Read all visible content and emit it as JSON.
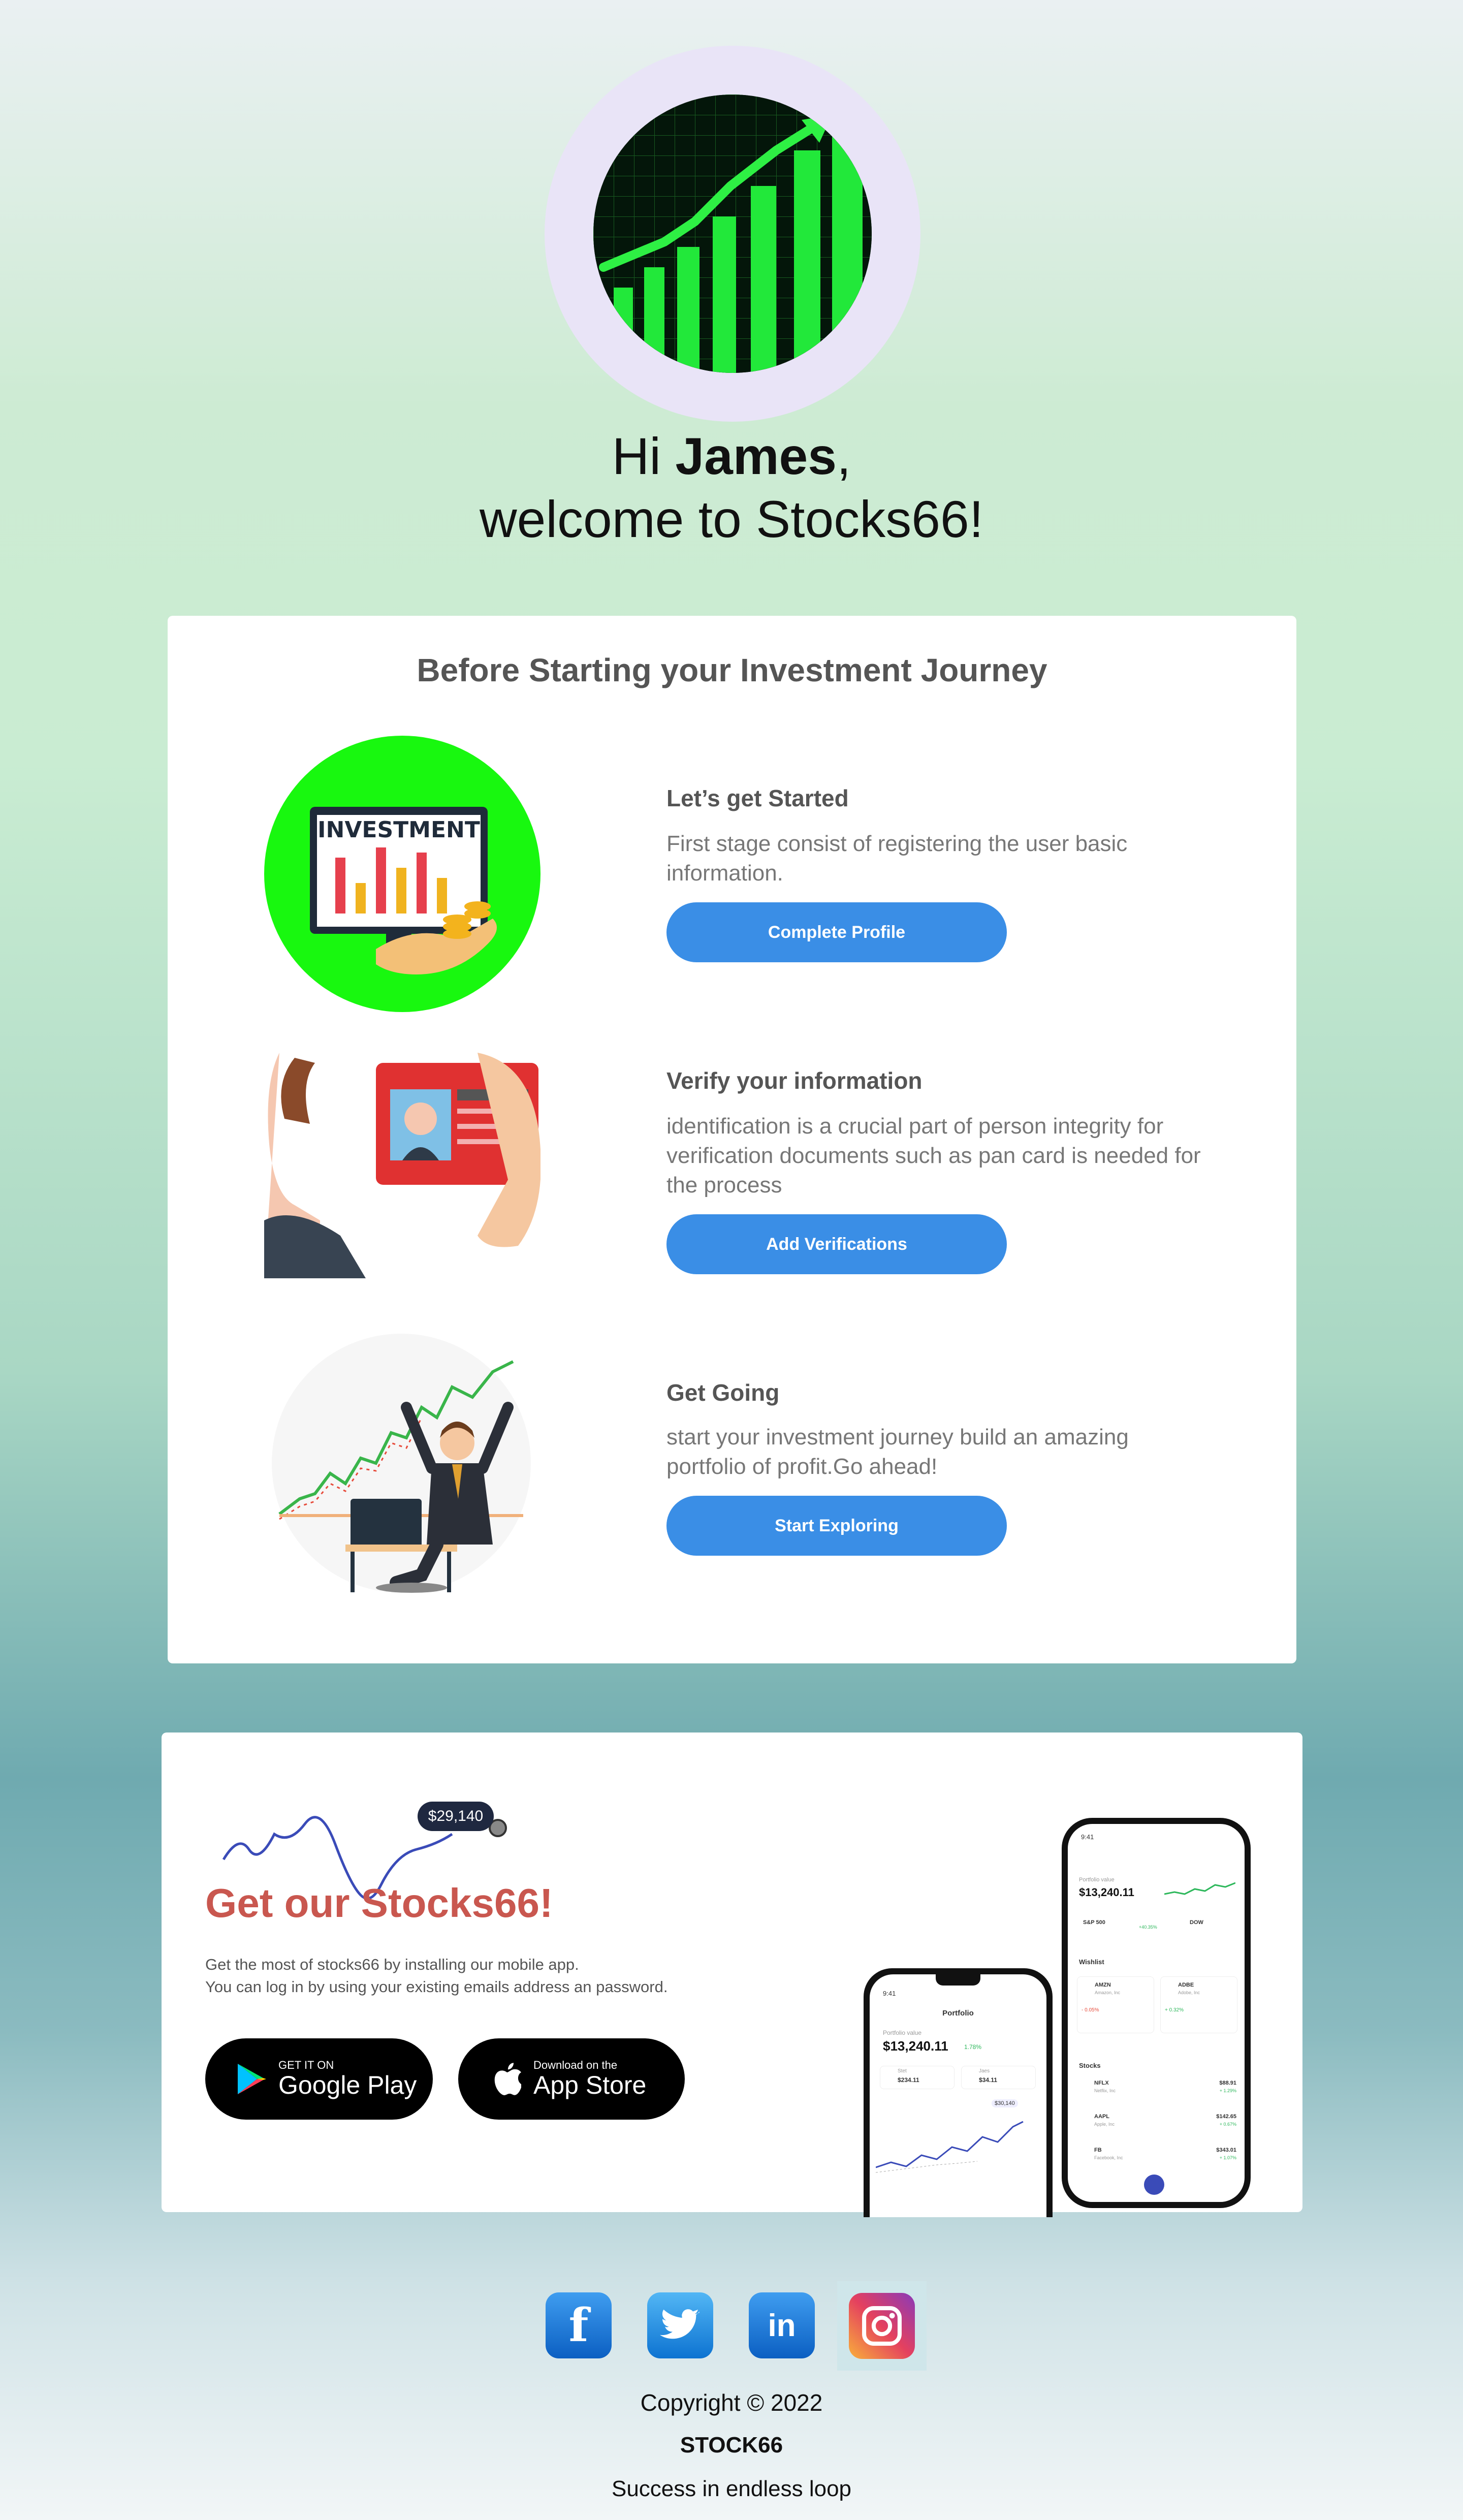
{
  "greeting": {
    "hi": "Hi",
    "name": "James",
    "comma": ",",
    "welcome": "welcome to Stocks66!"
  },
  "journey": {
    "title": "Before Starting your Investment Journey",
    "steps": [
      {
        "title": "Let’s get Started",
        "desc": "First stage consist of registering the user basic information.",
        "button": "Complete Profile",
        "illustration_label": "INVESTMENT"
      },
      {
        "title": "Verify your information",
        "desc": "identification is a crucial part of person integrity for verification documents such as pan card is needed for the process",
        "button": "Add Verifications"
      },
      {
        "title": "Get Going",
        "desc": "start your investment journey build an amazing portfolio of profit.Go ahead!",
        "button": "Start Exploring"
      }
    ]
  },
  "promo": {
    "price_tag": "$29,140",
    "title": "Get our Stocks66!",
    "desc_line1": "Get the most of stocks66 by installing our mobile app.",
    "desc_line2": "You can log in by using your existing emails address an password.",
    "google": {
      "small": "GET IT ON",
      "big": "Google Play"
    },
    "apple": {
      "small": "Download on the",
      "big": "App Store"
    },
    "phone_left": {
      "time": "9:41",
      "header": "Portfolio",
      "label": "Portfolio value",
      "value": "$13,240.11",
      "change": "1.78%",
      "chip1_name": "Stet",
      "chip1_value": "$234.11",
      "chip2_name": "Jaes",
      "chip2_value": "$34.11",
      "marker": "$30,140"
    },
    "phone_right": {
      "time": "9:41",
      "label": "Portfolio value",
      "value": "$13,240.11",
      "idx1": "S&P 500",
      "idx1_change": "+40.35%",
      "idx2": "DOW",
      "wishlist": "Wishlist",
      "w1": "AMZN",
      "w1_sub": "Amazon, Inc",
      "w1_change": "- 0.05%",
      "w2": "ADBE",
      "w2_sub": "Adobe, Inc",
      "w2_change": "+ 0.32%",
      "stocks": "Stocks",
      "rows": [
        {
          "ticker": "NFLX",
          "name": "Netflix, Inc",
          "price": "$88.91",
          "change": "+ 1.29%"
        },
        {
          "ticker": "AAPL",
          "name": "Apple, Inc",
          "price": "$142.65",
          "change": "+ 0.67%"
        },
        {
          "ticker": "FB",
          "name": "Facebook, Inc",
          "price": "$343.01",
          "change": "+ 1.07%"
        }
      ]
    }
  },
  "footer": {
    "copyright": "Copyright © 2022",
    "brand": "STOCK66",
    "tagline": "Success in endless loop",
    "socials": {
      "facebook": "f",
      "linkedin": "in"
    }
  },
  "colors": {
    "accent_blue": "#3a8ee6",
    "promo_red": "#c9574f",
    "hero_green": "#22e83a"
  }
}
